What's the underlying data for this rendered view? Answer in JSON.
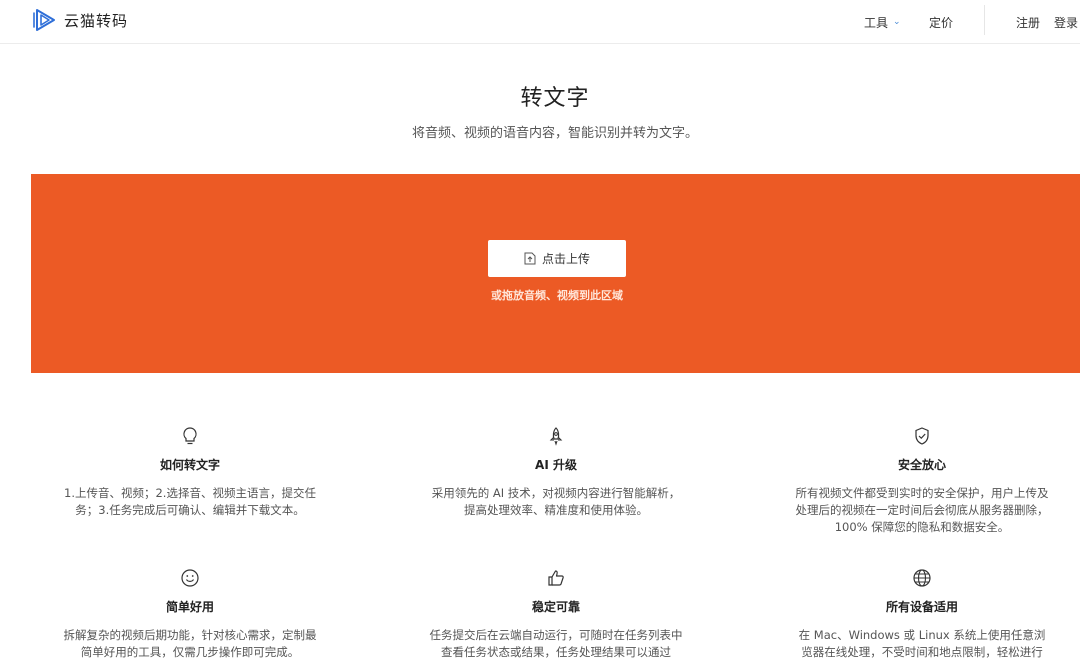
{
  "header": {
    "logo_text": "云猫转码",
    "nav": {
      "tools": "工具",
      "pricing": "定价",
      "register": "注册",
      "login": "登录"
    }
  },
  "hero": {
    "title": "转文字",
    "subtitle": "将音频、视频的语音内容，智能识别并转为文字。"
  },
  "upload": {
    "button_label": "点击上传",
    "hint": "或拖放音频、视频到此区域",
    "background_color": "#ec5a25"
  },
  "features": [
    {
      "icon": "lightbulb-icon",
      "title": "如何转文字",
      "desc": "1.上传音、视频；2.选择音、视频主语言，提交任务；3.任务完成后可确认、编辑并下载文本。"
    },
    {
      "icon": "rocket-icon",
      "title": "AI 升级",
      "desc": "采用领先的 AI 技术，对视频内容进行智能解析，提高处理效率、精准度和使用体验。"
    },
    {
      "icon": "shield-check-icon",
      "title": "安全放心",
      "desc": "所有视频文件都受到实时的安全保护，用户上传及处理后的视频在一定时间后会彻底从服务器删除，100% 保障您的隐私和数据安全。"
    },
    {
      "icon": "smile-icon",
      "title": "简单好用",
      "desc": "拆解复杂的视频后期功能，针对核心需求，定制最简单好用的工具，仅需几步操作即可完成。"
    },
    {
      "icon": "thumbs-up-icon",
      "title": "稳定可靠",
      "desc": "任务提交后在云端自动运行，可随时在任务列表中查看任务状态或结果，任务处理结果可以通过"
    },
    {
      "icon": "globe-icon",
      "title": "所有设备适用",
      "desc": "在 Mac、Windows 或 Linux 系统上使用任意浏览器在线处理，不受时间和地点限制，轻松进行"
    }
  ]
}
